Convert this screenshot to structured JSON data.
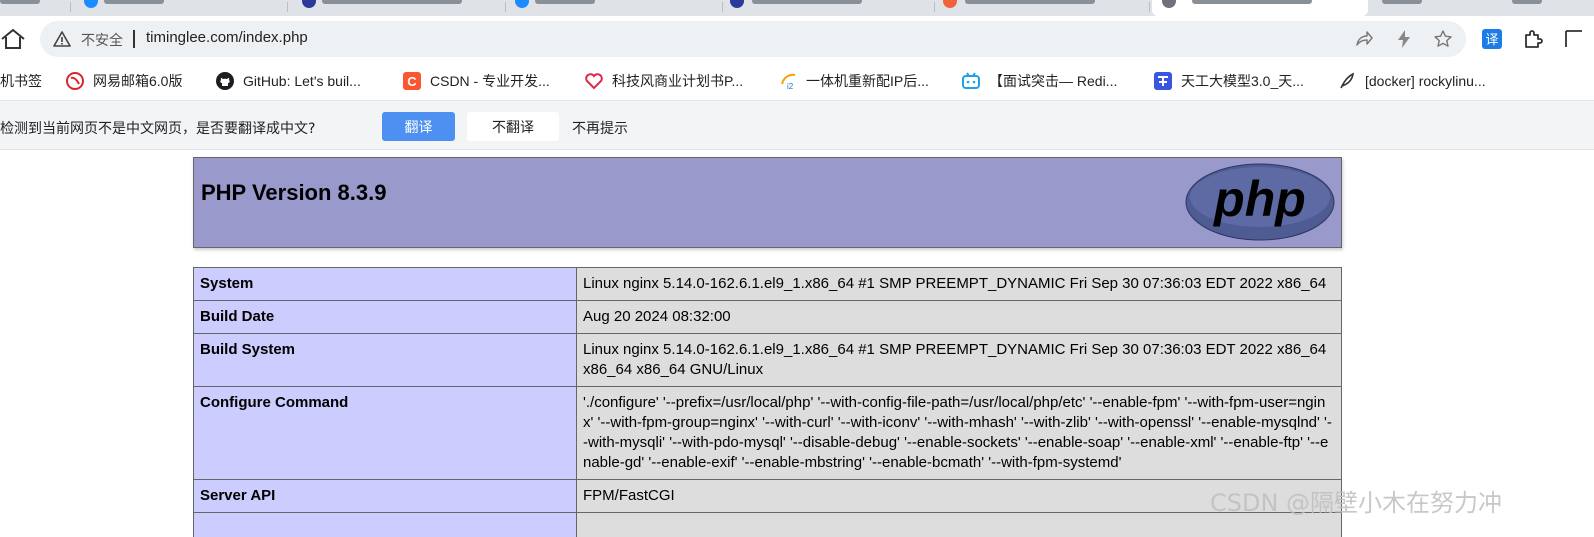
{
  "browser": {
    "omnibox": {
      "security_label": "不安全",
      "url": "timinglee.com/index.php"
    },
    "bookmarks": [
      {
        "label": "机书签",
        "icon": "folder-icon"
      },
      {
        "label": "网易邮箱6.0版",
        "icon": "netease-mail-icon"
      },
      {
        "label": "GitHub: Let's buil...",
        "icon": "github-icon"
      },
      {
        "label": "CSDN - 专业开发...",
        "icon": "csdn-icon"
      },
      {
        "label": "科技风商业计划书P...",
        "icon": "heart-icon"
      },
      {
        "label": "一体机重新配IP后...",
        "icon": "i2-icon"
      },
      {
        "label": "【面试突击— Redi...",
        "icon": "bilibili-icon"
      },
      {
        "label": "天工大模型3.0_天...",
        "icon": "tiangong-icon"
      },
      {
        "label": "[docker] rockylinu...",
        "icon": "feather-icon"
      }
    ],
    "translate_bar": {
      "message": "检测到当前网页不是中文网页，是否要翻译成中文?",
      "translate_label": "翻译",
      "no_translate_label": "不翻译",
      "never_label": "不再提示"
    }
  },
  "phpinfo": {
    "title": "PHP Version 8.3.9",
    "logo_text": "php",
    "rows": [
      {
        "key": "System",
        "value": "Linux nginx 5.14.0-162.6.1.el9_1.x86_64 #1 SMP PREEMPT_DYNAMIC Fri Sep 30 07:36:03 EDT 2022 x86_64"
      },
      {
        "key": "Build Date",
        "value": "Aug 20 2024 08:32:00"
      },
      {
        "key": "Build System",
        "value": "Linux nginx 5.14.0-162.6.1.el9_1.x86_64 #1 SMP PREEMPT_DYNAMIC Fri Sep 30 07:36:03 EDT 2022 x86_64 x86_64 x86_64 GNU/Linux"
      },
      {
        "key": "Configure Command",
        "value": "'./configure' '--prefix=/usr/local/php' '--with-config-file-path=/usr/local/php/etc' '--enable-fpm' '--with-fpm-user=nginx' '--with-fpm-group=nginx' '--with-curl' '--with-iconv' '--with-mhash' '--with-zlib' '--with-openssl' '--enable-mysqlnd' '--with-mysqli' '--with-pdo-mysql' '--disable-debug' '--enable-sockets' '--enable-soap' '--enable-xml' '--enable-ftp' '--enable-gd' '--enable-exif' '--enable-mbstring' '--enable-bcmath' '--with-fpm-systemd'"
      },
      {
        "key": "Server API",
        "value": "FPM/FastCGI"
      },
      {
        "key": "",
        "value": ""
      }
    ]
  },
  "watermark": "CSDN @隔壁小木在努力冲",
  "colors": {
    "php_header": "#9999cc",
    "key_cell": "#ccccff",
    "value_cell": "#dddddd",
    "translate_button": "#4d90f2"
  }
}
